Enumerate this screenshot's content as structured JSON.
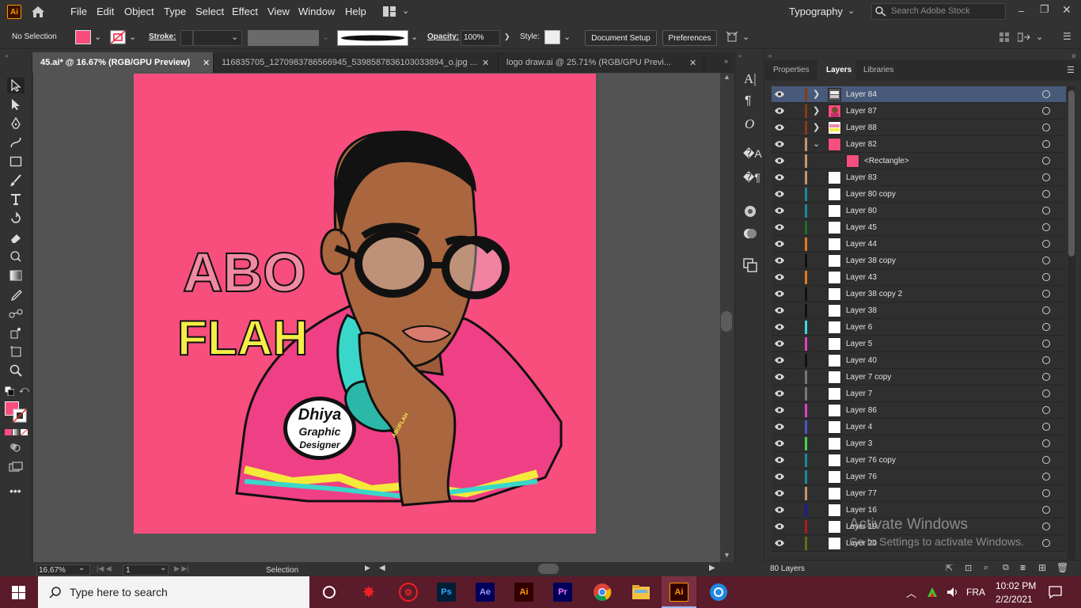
{
  "app": {
    "logo": "Ai",
    "workspace": "Typography",
    "search_placeholder": "Search Adobe Stock"
  },
  "menu": [
    "File",
    "Edit",
    "Object",
    "Type",
    "Select",
    "Effect",
    "View",
    "Window",
    "Help"
  ],
  "control": {
    "selection": "No Selection",
    "stroke_label": "Stroke:",
    "opacity_label": "Opacity:",
    "opacity_value": "100%",
    "style_label": "Style:",
    "document_setup": "Document Setup",
    "preferences": "Preferences",
    "fill_color": "#f74e7e"
  },
  "tabs": [
    {
      "label": "45.ai* @ 16.67% (RGB/GPU Preview)",
      "active": true
    },
    {
      "label": "116835705_1270983786566945_5398587836103033894_o.jpg ...",
      "active": false
    },
    {
      "label": "logo draw.ai @ 25.71% (RGB/GPU Previ...",
      "active": false
    }
  ],
  "artwork": {
    "text_line1": "ABO",
    "text_line2": "FLAH",
    "badge_line1": "Dhiya",
    "badge_line2": "Graphic",
    "badge_line3": "Designer",
    "headphone_brand": "ABOFLAH",
    "bg_color": "#f74e7e"
  },
  "panel": {
    "tabs": [
      "Properties",
      "Layers",
      "Libraries"
    ],
    "active_tab": "Layers",
    "layer_count": "80 Layers",
    "layers": [
      {
        "name": "Layer 84",
        "color": "#8b3a12",
        "thumb": "art",
        "twist": "›",
        "sel": true
      },
      {
        "name": "Layer 87",
        "color": "#8b3a12",
        "thumb": "face",
        "twist": "›"
      },
      {
        "name": "Layer 88",
        "color": "#8b3a12",
        "thumb": "text",
        "twist": "›"
      },
      {
        "name": "Layer 82",
        "color": "#c8956a",
        "thumb": "pink",
        "twist": "⌄"
      },
      {
        "name": "<Rectangle>",
        "color": "#c8956a",
        "thumb": "pink",
        "indent": true
      },
      {
        "name": "Layer 83",
        "color": "#c8956a",
        "thumb": "white"
      },
      {
        "name": "Layer 80 copy",
        "color": "#1a8aa0",
        "thumb": "white"
      },
      {
        "name": "Layer 80",
        "color": "#1a8aa0",
        "thumb": "white"
      },
      {
        "name": "Layer 45",
        "color": "#1f6b2a",
        "thumb": "white"
      },
      {
        "name": "Layer 44",
        "color": "#e07a1c",
        "thumb": "white"
      },
      {
        "name": "Layer 38 copy",
        "color": "#111111",
        "thumb": "white"
      },
      {
        "name": "Layer 43",
        "color": "#e07a1c",
        "thumb": "white"
      },
      {
        "name": "Layer 38 copy 2",
        "color": "#111111",
        "thumb": "white"
      },
      {
        "name": "Layer 38",
        "color": "#111111",
        "thumb": "white"
      },
      {
        "name": "Layer 6",
        "color": "#3ed6e6",
        "thumb": "white"
      },
      {
        "name": "Layer 5",
        "color": "#e040c0",
        "thumb": "white"
      },
      {
        "name": "Layer 40",
        "color": "#111111",
        "thumb": "white"
      },
      {
        "name": "Layer 7 copy",
        "color": "#777777",
        "thumb": "white"
      },
      {
        "name": "Layer 7",
        "color": "#777777",
        "thumb": "white"
      },
      {
        "name": "Layer 86",
        "color": "#e040c0",
        "thumb": "white"
      },
      {
        "name": "Layer 4",
        "color": "#4a55c8",
        "thumb": "white"
      },
      {
        "name": "Layer 3",
        "color": "#4ad64a",
        "thumb": "white"
      },
      {
        "name": "Layer 76 copy",
        "color": "#1a8aa0",
        "thumb": "white"
      },
      {
        "name": "Layer 76",
        "color": "#1a8aa0",
        "thumb": "white"
      },
      {
        "name": "Layer 77",
        "color": "#c8956a",
        "thumb": "white"
      },
      {
        "name": "Layer 16",
        "color": "#1a1aa0",
        "thumb": "white"
      },
      {
        "name": "Layer 19",
        "color": "#b01a1a",
        "thumb": "white"
      },
      {
        "name": "Layer 20",
        "color": "#6a6a1a",
        "thumb": "white"
      }
    ]
  },
  "status": {
    "zoom": "16.67%",
    "artboard": "1",
    "tool": "Selection"
  },
  "watermark": {
    "line1": "Activate Windows",
    "line2": "Go to Settings to activate Windows."
  },
  "taskbar": {
    "search": "Type here to search",
    "apps": [
      "Ps",
      "Ae",
      "Ai",
      "Pr",
      "Ai"
    ],
    "lang": "FRA",
    "time": "10:02 PM",
    "date": "2/2/2021"
  }
}
